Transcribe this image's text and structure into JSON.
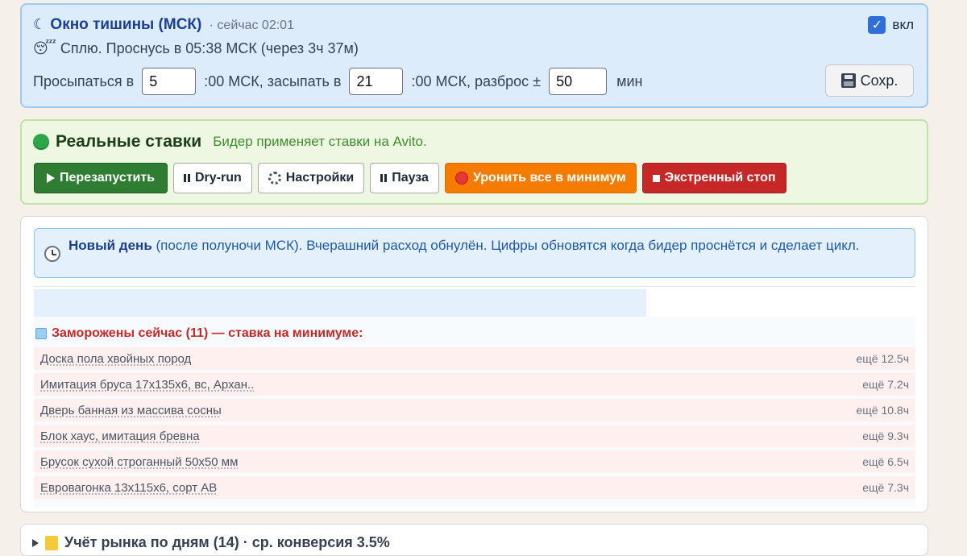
{
  "quiet": {
    "title": "Окно тишины (МСК)",
    "now": "· сейчас 02:01",
    "status": "Сплю. Проснусь в 05:38 МСК (через 3ч 37м)",
    "toggle_label": "вкл",
    "toggle_checked": true,
    "wake_label": "Просыпаться в",
    "wake_value": "5",
    "sleep_label": ":00 МСК, засыпать в",
    "sleep_value": "21",
    "spread_label": ":00 МСК, разброс ±",
    "spread_value": "50",
    "spread_unit": "мин",
    "save_label": "Сохр."
  },
  "live": {
    "title": "Реальные ставки",
    "subtitle": "Бидер применяет ставки на Avito.",
    "buttons": {
      "restart": "Перезапустить",
      "dryrun": "Dry-run",
      "settings": "Настройки",
      "pause": "Пауза",
      "drop": "Уронить все в минимум",
      "stop": "Экстренный стоп"
    }
  },
  "main": {
    "info_bold": "Новый день",
    "info_text": " (после полуночи МСК). Вчерашний расход обнулён. Цифры обновятся когда бидер проснётся и сделает цикл.",
    "frozen_title": "Заморожены сейчас (11) — ставка на минимуме:",
    "frozen_items": [
      {
        "name": "Доска пола хвойных пород",
        "left": "ещё 12.5ч"
      },
      {
        "name": "Имитация бруса 17х135х6, вс, Архан..",
        "left": "ещё 7.2ч"
      },
      {
        "name": "Дверь банная из массива сосны",
        "left": "ещё 10.8ч"
      },
      {
        "name": "Блок хаус, имитация бревна",
        "left": "ещё 9.3ч"
      },
      {
        "name": "Брусок сухой строганный 50х50 мм",
        "left": "ещё 6.5ч"
      },
      {
        "name": "Евровагонка 13х115х6, сорт АВ",
        "left": "ещё 7.3ч"
      }
    ]
  },
  "report": {
    "title": "Учёт рынка по дням (14) · ср. конверсия 3.5%"
  }
}
